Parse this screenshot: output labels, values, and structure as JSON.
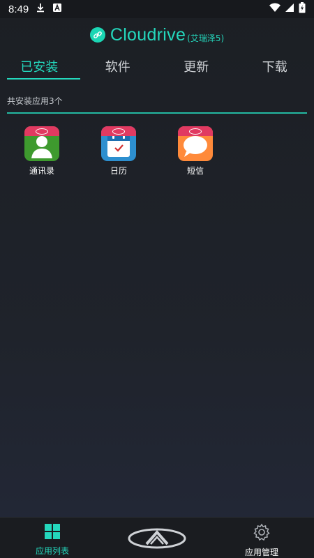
{
  "status": {
    "time": "8:49"
  },
  "header": {
    "title": "Cloudrive",
    "subtitle": "(艾瑞泽5)"
  },
  "tabs": [
    {
      "label": "已安装",
      "active": true
    },
    {
      "label": "软件",
      "active": false
    },
    {
      "label": "更新",
      "active": false
    },
    {
      "label": "下载",
      "active": false
    }
  ],
  "installed": {
    "count_text": "共安装应用3个",
    "apps": [
      {
        "name": "通讯录",
        "icon": "contacts-icon",
        "color": "#3e9a2e"
      },
      {
        "name": "日历",
        "icon": "calendar-icon",
        "color": "#2d8fcf"
      },
      {
        "name": "短信",
        "icon": "messages-icon",
        "color": "#ff8a3a"
      }
    ]
  },
  "bottom_nav": {
    "left_label": "应用列表",
    "right_label": "应用管理"
  },
  "colors": {
    "accent": "#24d8bd",
    "background": "#1c1f24"
  }
}
